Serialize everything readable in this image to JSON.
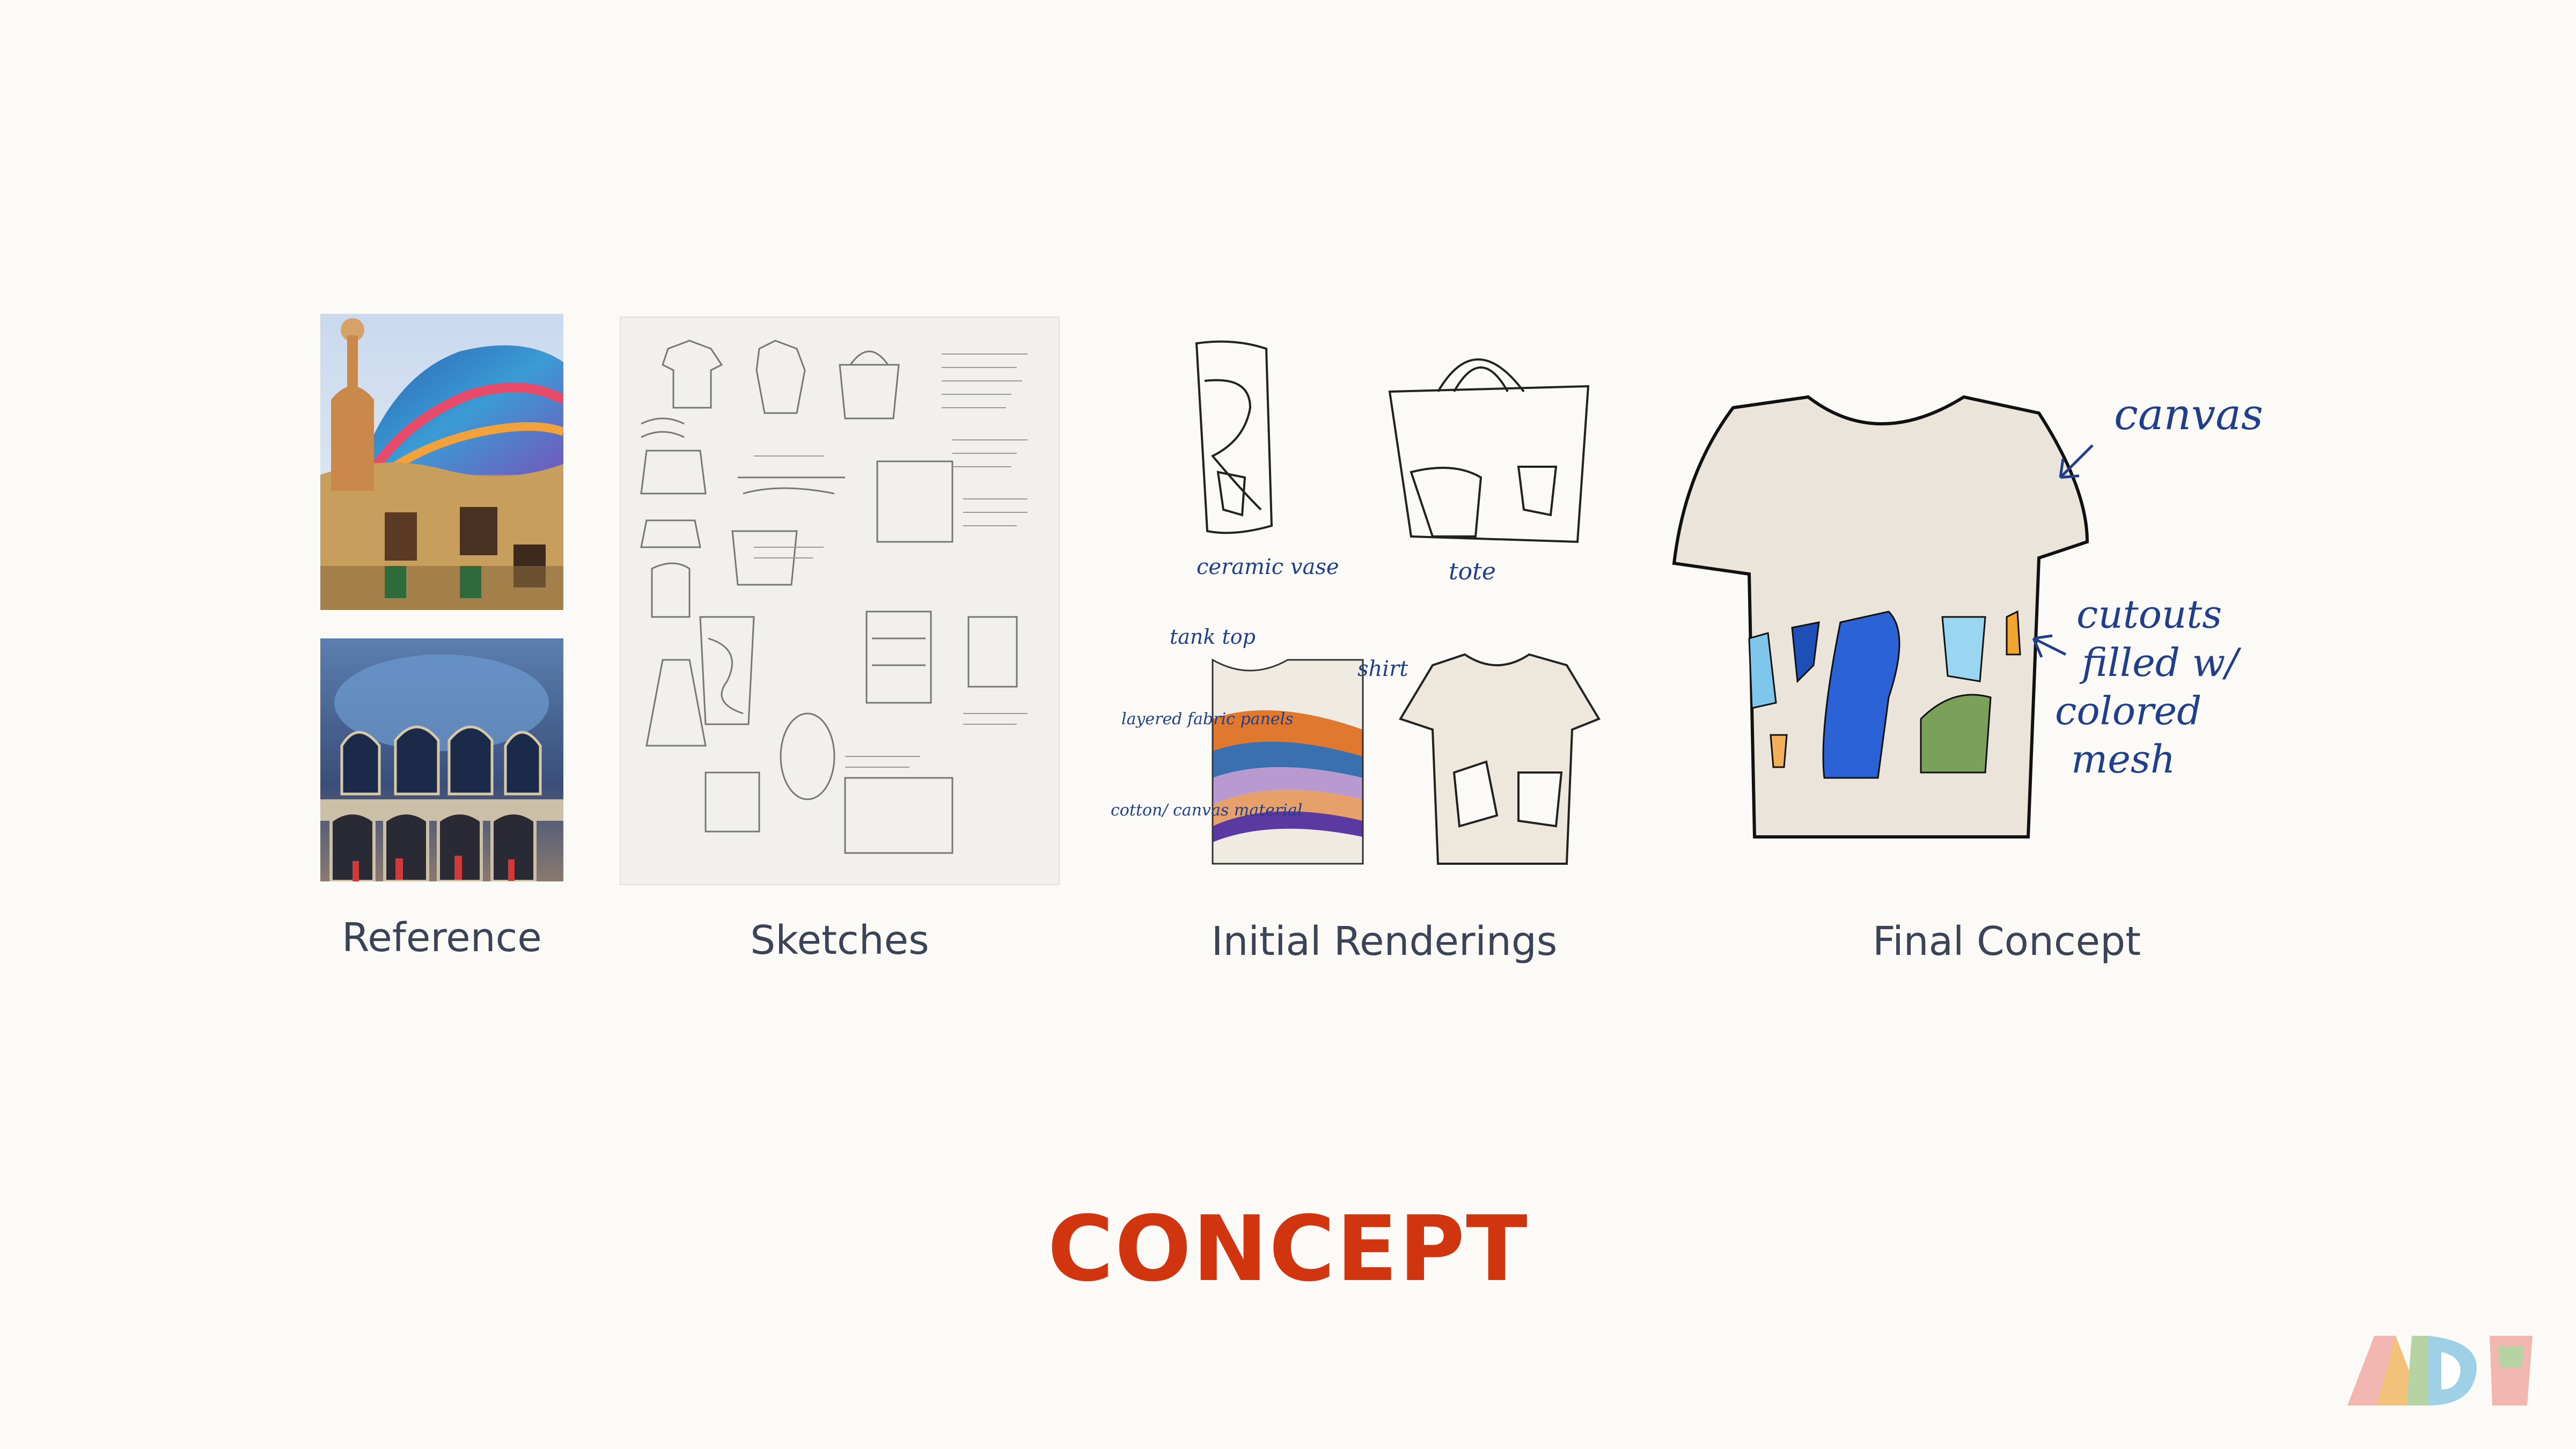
{
  "slide": {
    "title": "CONCEPT",
    "title_color": "#d03510",
    "background": "#fcfaf7"
  },
  "sections": [
    {
      "id": "reference",
      "caption": "Reference"
    },
    {
      "id": "sketches",
      "caption": "Sketches"
    },
    {
      "id": "renderings",
      "caption": "Initial Renderings"
    },
    {
      "id": "final",
      "caption": "Final Concept"
    }
  ],
  "renderings": {
    "vase_label": "ceramic vase",
    "tote_label": "tote",
    "tank_label": "tank top",
    "shirt_label": "shirt",
    "layered_label": "layered fabric panels",
    "cotton_label": "cotton/ canvas material"
  },
  "final": {
    "canvas_label": "canvas",
    "cutouts_label_1": "cutouts",
    "cutouts_label_2": "filled w/",
    "cutouts_label_3": "colored",
    "cutouts_label_4": "mesh"
  },
  "logo": {
    "icon": "adi-logo-icon",
    "colors": [
      "#f3b7b2",
      "#f2c27a",
      "#b7d3a3",
      "#9fd1e6",
      "#ffffff"
    ]
  }
}
